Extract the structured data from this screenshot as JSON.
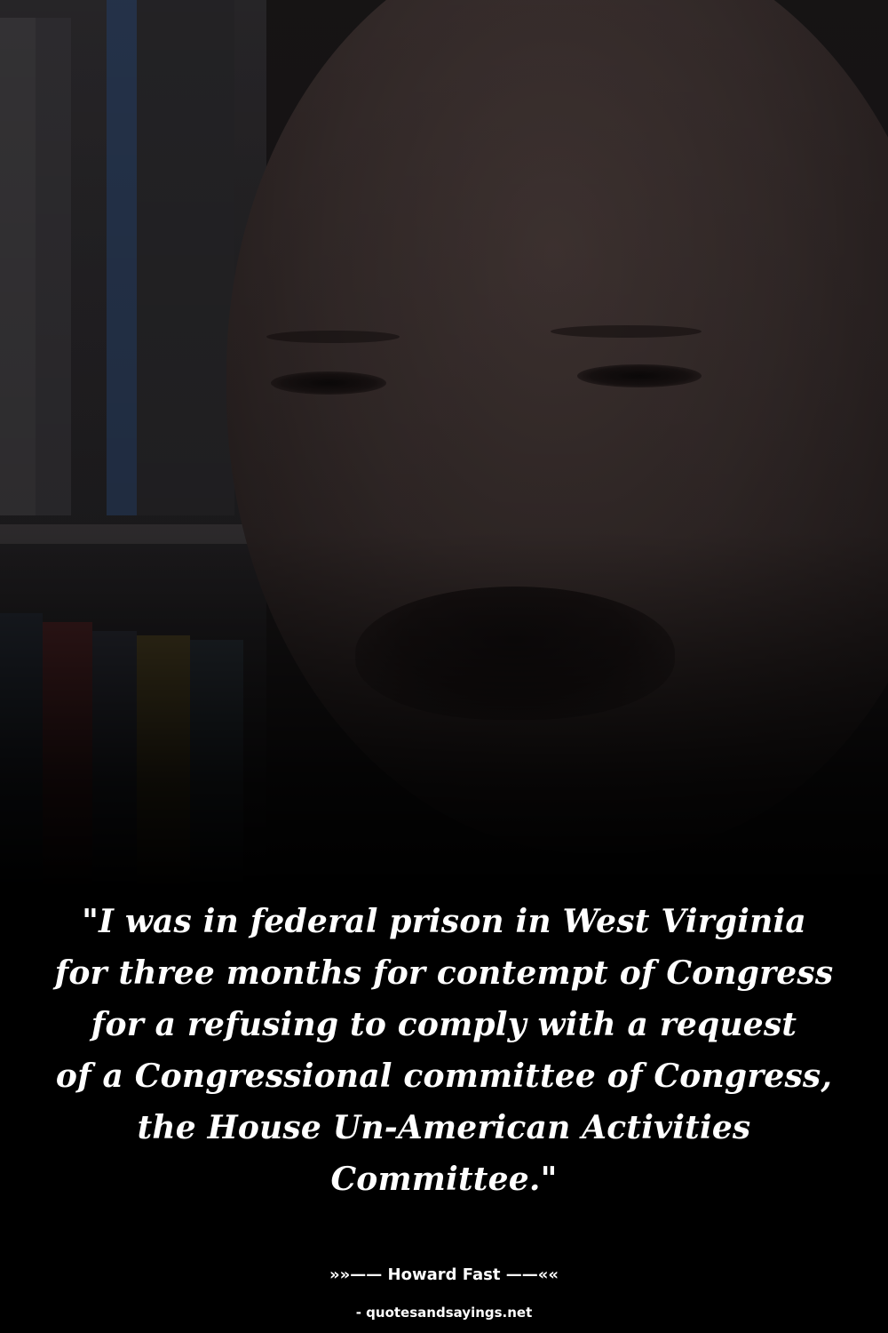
{
  "photo": {
    "subject": "portrait-photo"
  },
  "quote": {
    "lines": [
      "\"I was in federal prison in West Virginia",
      "for three months for contempt of Congress",
      "for a refusing to comply with a request",
      "of a Congressional committee of Congress,",
      "the House Un-American Activities",
      "Committee.\""
    ]
  },
  "author": {
    "text": "»»—— Howard Fast ——««"
  },
  "site": {
    "text": "- quotesandsayings.net"
  },
  "colors": {
    "background": "#000000",
    "text": "#ffffff"
  }
}
